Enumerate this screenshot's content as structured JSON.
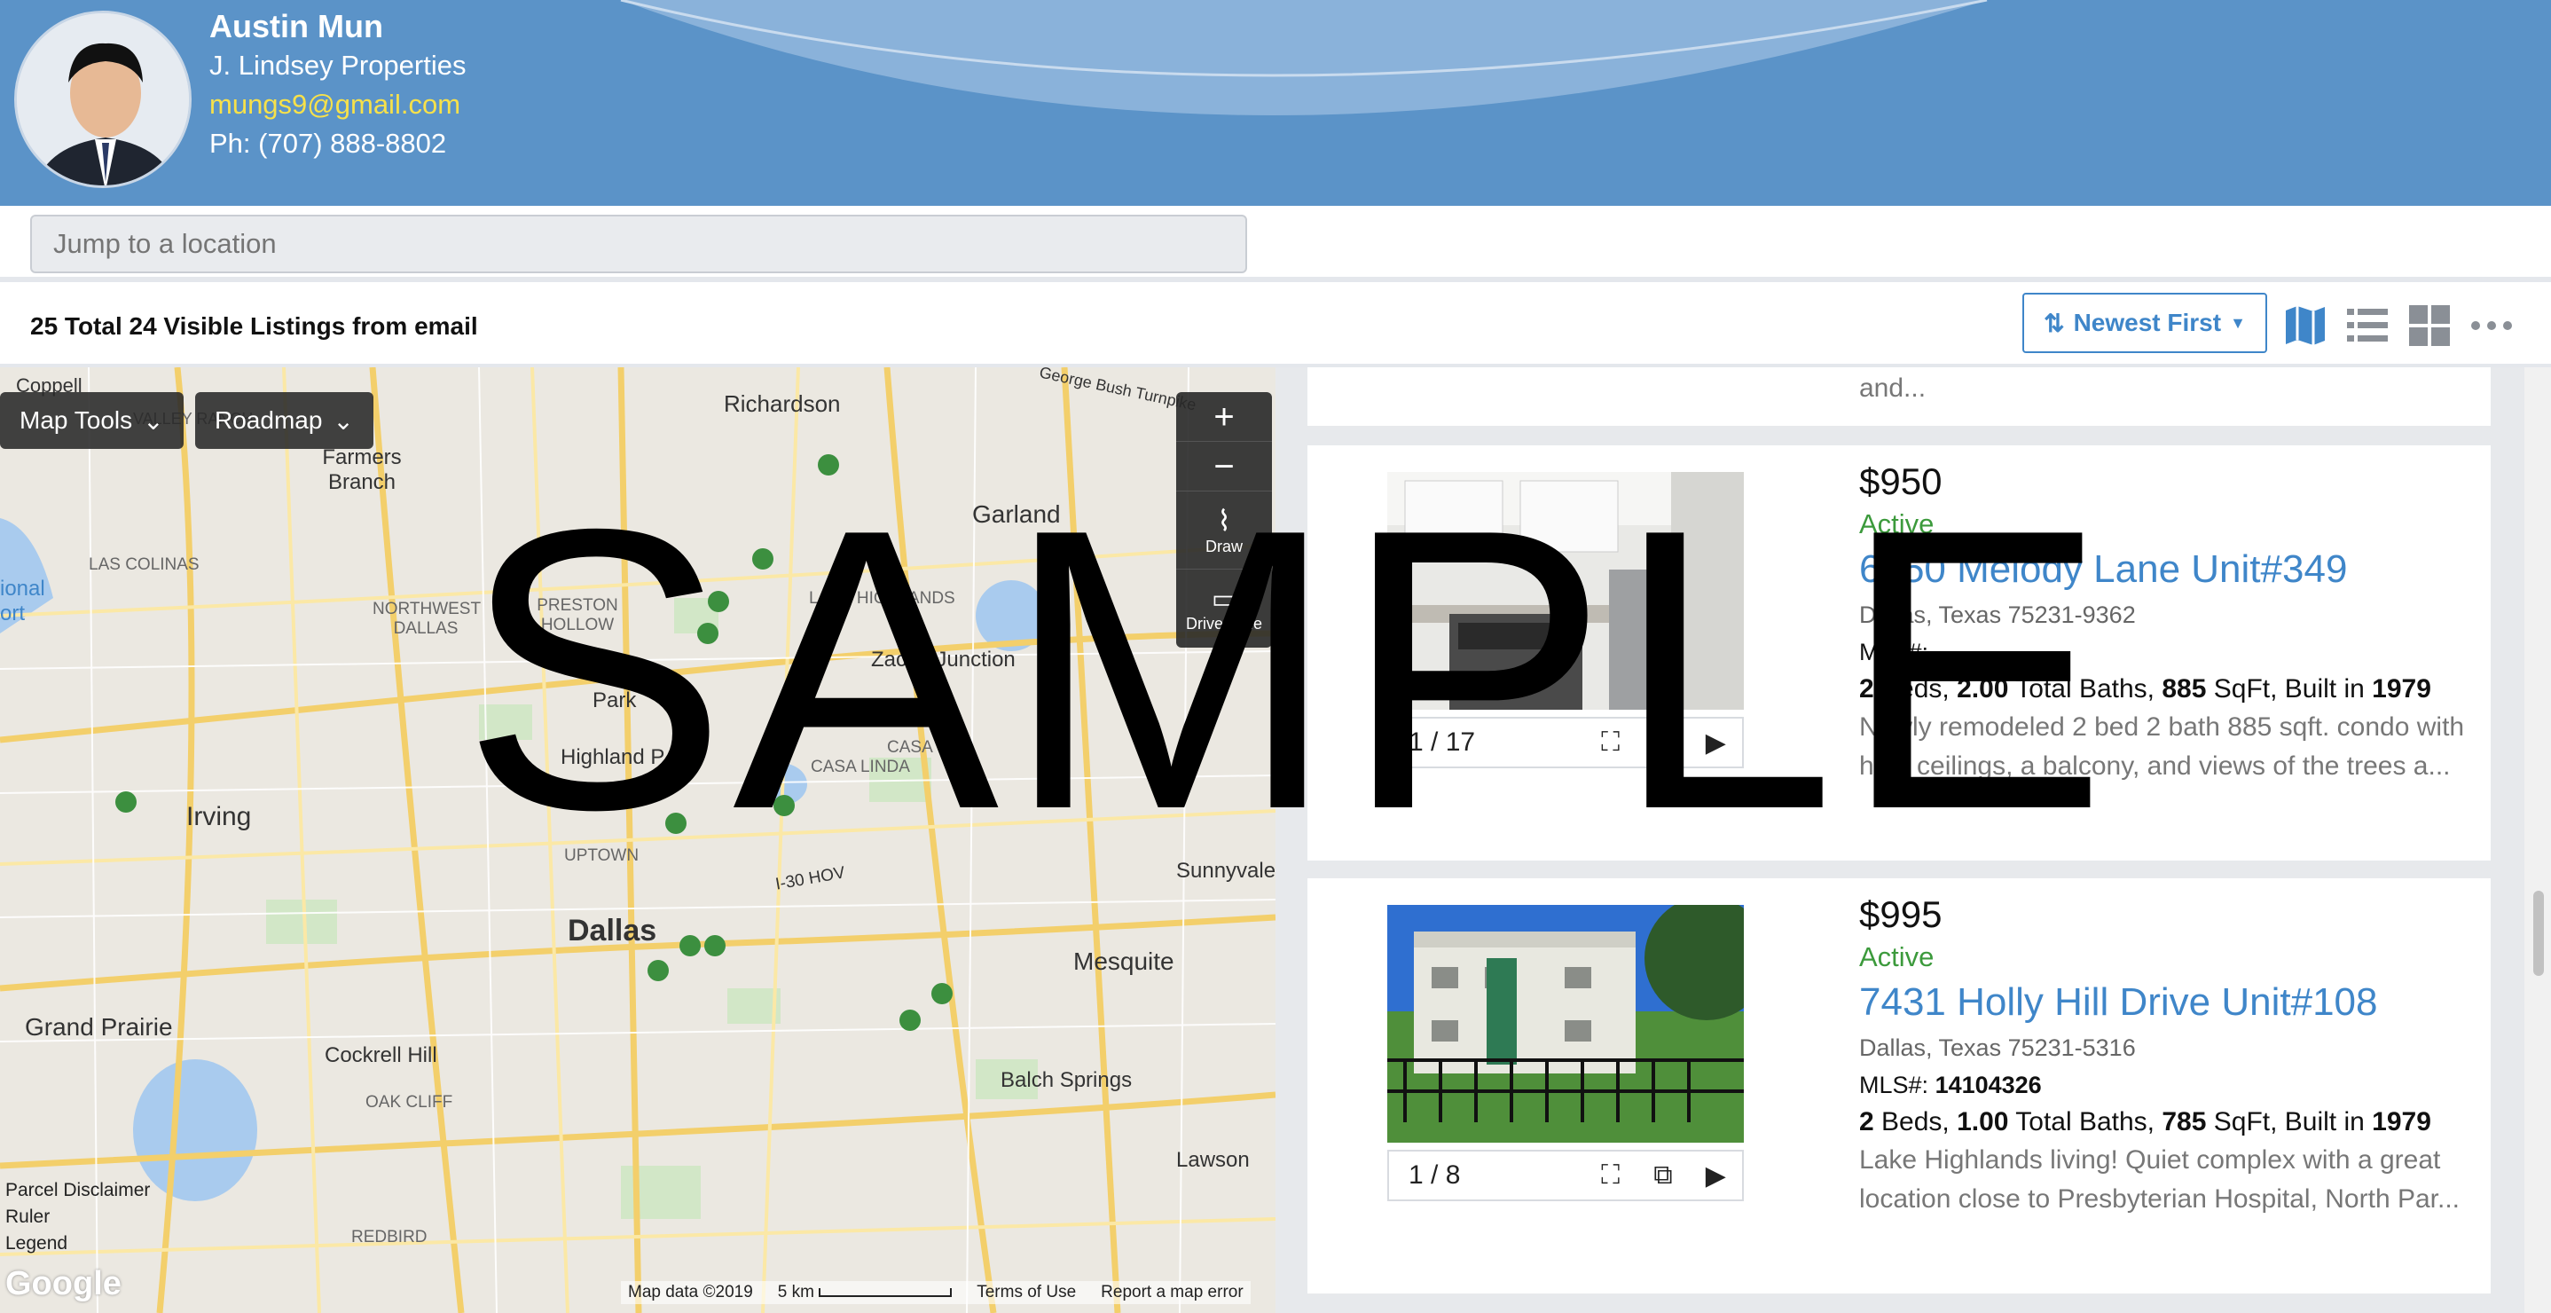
{
  "agent": {
    "name": "Austin Mun",
    "company": "J. Lindsey Properties",
    "email": "mungs9@gmail.com",
    "phone": "Ph: (707) 888-8802"
  },
  "search": {
    "placeholder": "Jump to a location"
  },
  "results": {
    "summary": "25 Total 24 Visible Listings from email",
    "sort_label": "Newest First"
  },
  "view_icons": [
    "map-view-icon",
    "list-view-icon",
    "grid-view-icon",
    "more-icon"
  ],
  "map": {
    "tools_label": "Map Tools",
    "type_label": "Roadmap",
    "zoom_in": "+",
    "zoom_out": "−",
    "draw_label": "Draw",
    "drivetime_label": "Drive Time",
    "labels": {
      "coppell": "Coppell",
      "valley_ranch": "VALLEY RANCH",
      "richardson": "Richardson",
      "george_bush": "George Bush Turnpike",
      "farmers_branch": "Farmers Branch",
      "garland": "Garland",
      "las_colinas": "LAS COLINAS",
      "northwest_dallas": "NORTHWEST DALLAS",
      "preston_hollow": "PRESTON HOLLOW",
      "lake_highlands": "LAKE HIGHLANDS",
      "zacha_junction": "Zacha Junction",
      "national_airport": "ional ort",
      "park": "Park",
      "highland_park": "Highland P",
      "casa_linda": "CASA LINDA",
      "casa_view": "CASA",
      "irving": "Irving",
      "uptown": "UPTOWN",
      "i30_hov": "I-30 HOV",
      "sunnyvale": "Sunnyvale",
      "dallas": "Dallas",
      "mesquite": "Mesquite",
      "grand_prairie": "Grand Prairie",
      "cockrell_hill": "Cockrell Hill",
      "oak_cliff": "OAK CLIFF",
      "balch_springs": "Balch Springs",
      "lawson": "Lawson",
      "redbird": "REDBIRD"
    },
    "side_links": {
      "parcel": "Parcel Disclaimer",
      "ruler": "Ruler",
      "legend": "Legend"
    },
    "google": "Google",
    "footer": {
      "data": "Map data ©2019",
      "scale": "5 km",
      "terms": "Terms of Use",
      "report": "Report a map error"
    }
  },
  "listings": {
    "previous_tail": "and...",
    "items": [
      {
        "price": "$950",
        "status": "Active",
        "address": "6050 Melody Lane Unit#349",
        "city": "Dallas, Texas 75231-9362",
        "mls_label": "MLS#:",
        "mls": "",
        "beds": "2",
        "beds_label": " Beds, ",
        "baths": "2.00",
        "baths_label": " Total Baths, ",
        "sqft": "885",
        "sqft_label": " SqFt, Built in ",
        "year": "1979",
        "description": "Newly remodeled 2 bed 2 bath 885 sqft. condo with high ceilings, a balcony, and views of the trees a...",
        "photo_counter": "1 / 17"
      },
      {
        "price": "$995",
        "status": "Active",
        "address": "7431 Holly Hill Drive Unit#108",
        "city": "Dallas, Texas 75231-5316",
        "mls_label": "MLS#:",
        "mls": "14104326",
        "beds": "2",
        "beds_label": " Beds, ",
        "baths": "1.00",
        "baths_label": " Total Baths, ",
        "sqft": "785",
        "sqft_label": " SqFt, Built in ",
        "year": "1979",
        "description": "Lake Highlands living! Quiet complex with a great location close to Presbyterian Hospital, North Par...",
        "photo_counter": "1 / 8"
      }
    ]
  },
  "watermark": "SAMPLE",
  "colors": {
    "header": "#5b93c8",
    "accent": "#3f86c9",
    "active": "#3c9a3c",
    "email": "#f7e14a"
  }
}
